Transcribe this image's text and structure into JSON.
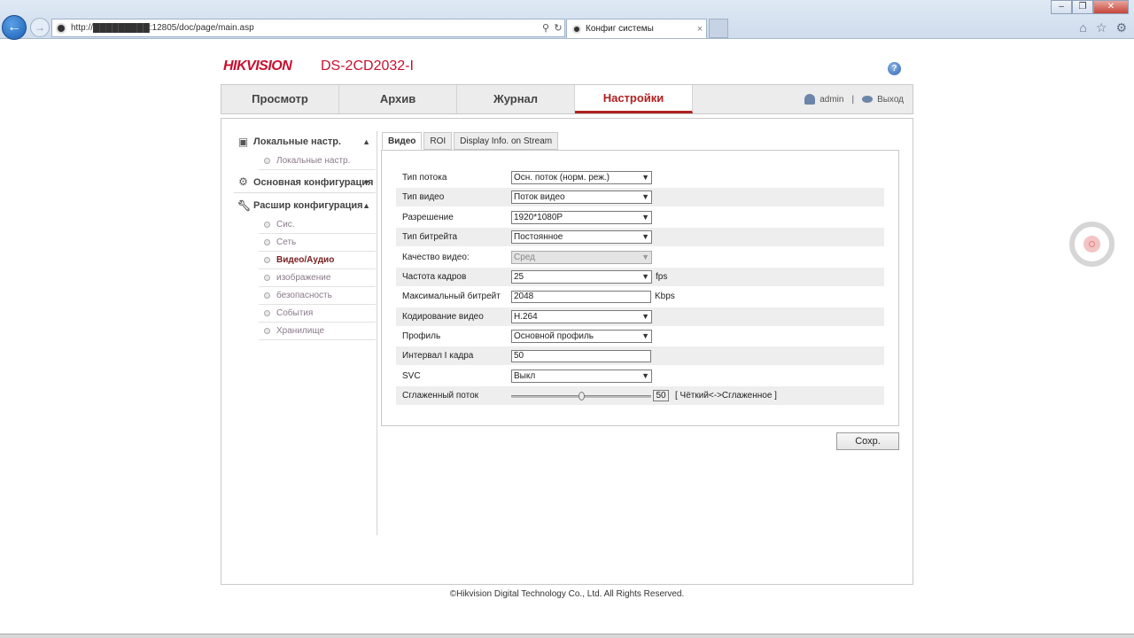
{
  "browser": {
    "url": "http://█████████:12805/doc/page/main.asp",
    "tab_title": "Конфиг системы",
    "search_glyph": "⚲",
    "refresh_glyph": "↻",
    "close_glyph": "×"
  },
  "header": {
    "logo": "HIKVISION",
    "model": "DS-2CD2032-I",
    "help": "?"
  },
  "menu": {
    "tabs": [
      {
        "label": "Просмотр",
        "active": false
      },
      {
        "label": "Архив",
        "active": false
      },
      {
        "label": "Журнал",
        "active": false
      },
      {
        "label": "Настройки",
        "active": true
      }
    ],
    "user": "admin",
    "separator": "|",
    "logout": "Выход"
  },
  "sidebar": {
    "groups": [
      {
        "label": "Локальные настр.",
        "icon": "monitor-icon",
        "caret": "▲",
        "items": [
          "Локальные настр."
        ]
      },
      {
        "label": "Основная конфигурация",
        "icon": "gear-icon",
        "caret": "▼",
        "items": []
      },
      {
        "label": "Расшир конфигурация",
        "icon": "wrench-icon",
        "caret": "▲",
        "items": [
          "Сис.",
          "Сеть",
          "Видео/Аудио",
          "изображение",
          "безопасность",
          "События",
          "Хранилище"
        ]
      }
    ],
    "active_item": "Видео/Аудио"
  },
  "subtabs": [
    {
      "label": "Видео",
      "active": true
    },
    {
      "label": "ROI",
      "active": false
    },
    {
      "label": "Display Info. on Stream",
      "active": false
    }
  ],
  "form": {
    "rows": [
      {
        "label": "Тип потока",
        "type": "select",
        "value": "Осн. поток (норм. реж.)"
      },
      {
        "label": "Тип видео",
        "type": "select",
        "value": "Поток видео"
      },
      {
        "label": "Разрешение",
        "type": "select",
        "value": "1920*1080P"
      },
      {
        "label": "Тип битрейта",
        "type": "select",
        "value": "Постоянное"
      },
      {
        "label": "Качество видео:",
        "type": "select",
        "value": "Сред",
        "disabled": true
      },
      {
        "label": "Частота кадров",
        "type": "select",
        "value": "25",
        "unit": "fps"
      },
      {
        "label": "Максимальный битрейт",
        "type": "text",
        "value": "2048",
        "unit": "Kbps"
      },
      {
        "label": "Кодирование видео",
        "type": "select",
        "value": "H.264"
      },
      {
        "label": "Профиль",
        "type": "select",
        "value": "Основной профиль"
      },
      {
        "label": "Интервал I кадра",
        "type": "text",
        "value": "50"
      },
      {
        "label": "SVC",
        "type": "select",
        "value": "Выкл"
      },
      {
        "label": "Сглаженный поток",
        "type": "slider",
        "value": "50",
        "level": 0.5,
        "hint": "[ Чёткий<->Сглаженное ]"
      }
    ],
    "save_label": "Сохр."
  },
  "footer": "©Hikvision Digital Technology Co., Ltd. All Rights Reserved.",
  "colors": {
    "brand": "#c8102e",
    "active_tab": "#b02121"
  }
}
